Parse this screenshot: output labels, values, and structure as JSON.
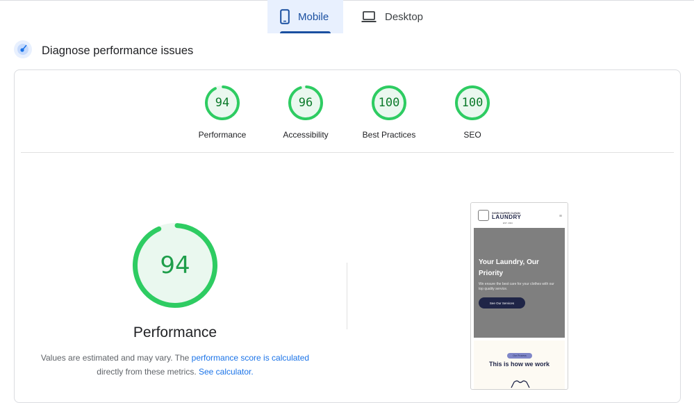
{
  "tabs": [
    {
      "label": "Mobile",
      "icon": "smartphone-icon",
      "active": true
    },
    {
      "label": "Desktop",
      "icon": "laptop-icon",
      "active": false
    }
  ],
  "diagnose": {
    "title": "Diagnose performance issues",
    "icon": "gauge-icon"
  },
  "categories": [
    {
      "label": "Performance",
      "score": 94
    },
    {
      "label": "Accessibility",
      "score": 96
    },
    {
      "label": "Best Practices",
      "score": 100
    },
    {
      "label": "SEO",
      "score": 100
    }
  ],
  "main": {
    "score": 94,
    "title": "Performance",
    "desc_prefix": "Values are estimated and may vary. The ",
    "link1": "performance score is calculated",
    "desc_mid": " directly from these metrics. ",
    "link2": "See calculator."
  },
  "colors": {
    "pass": "#0cce6b",
    "pass_bg": "#eaf8ef",
    "accent": "#1a73e8"
  },
  "screenshot": {
    "brand_top": "SIGRI SUPER CLEAN",
    "brand": "LAUNDRY",
    "est": "EST. 2024",
    "menu_icon": "≡",
    "hero_title": "Your Laundry, Our Priority",
    "hero_sub": "We ensure the best care for your clothes with our top quality service.",
    "hero_button": "See Our Services",
    "pill": "Our Process",
    "section_title": "This is how we work"
  }
}
